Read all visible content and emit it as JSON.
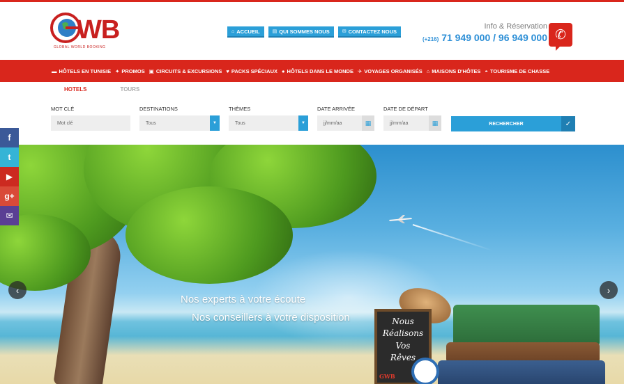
{
  "logo": {
    "text": "WB",
    "tagline": "GLOBAL WORLD BOOKING"
  },
  "topnav": [
    {
      "label": "ACCUEIL",
      "icon": "home-icon"
    },
    {
      "label": "QUI SOMMES NOUS",
      "icon": "file-icon"
    },
    {
      "label": "CONTACTEZ NOUS",
      "icon": "envelope-icon"
    }
  ],
  "contact": {
    "label": "Info & Réservation",
    "prefix": "(+216)",
    "numbers": "71 949 000 / 96 949 000"
  },
  "mainnav": [
    {
      "label": "HÔTELS EN TUNISIE",
      "icon": "bed-icon"
    },
    {
      "label": "PROMOS",
      "icon": "gift-icon"
    },
    {
      "label": "CIRCUITS & EXCURSIONS",
      "icon": "bus-icon"
    },
    {
      "label": "PACKS SPÉCIAUX",
      "icon": "heart-icon"
    },
    {
      "label": "HÔTELS DANS LE MONDE",
      "icon": "globe-icon"
    },
    {
      "label": "VOYAGES ORGANISÉS",
      "icon": "plane-icon"
    },
    {
      "label": "MAISONS D'HÔTES",
      "icon": "home-icon"
    },
    {
      "label": "TOURISME DE CHASSE",
      "icon": "hat-icon"
    }
  ],
  "tabs": {
    "hotels": "HOTELS",
    "tours": "TOURS"
  },
  "search": {
    "keyword_label": "MOT CLÉ",
    "keyword_placeholder": "Mot clé",
    "destinations_label": "DESTINATIONS",
    "destinations_value": "Tous",
    "themes_label": "THÈMES",
    "themes_value": "Tous",
    "arrival_label": "DATE ARRIVÉE",
    "arrival_placeholder": "jj/mm/aa",
    "departure_label": "DATE DE DÉPART",
    "departure_placeholder": "jj/mm/aa",
    "submit": "RECHERCHER"
  },
  "hero": {
    "line1": "Nos experts à votre écoute",
    "line2": "Nos conseillers à votre disposition",
    "board_lines": [
      "Nous",
      "Réalisons",
      "Vos",
      "Rêves"
    ],
    "board_logo": "GWB"
  },
  "social": [
    {
      "icon": "facebook-icon",
      "glyph": "f",
      "color": "#3b5998"
    },
    {
      "icon": "twitter-icon",
      "glyph": "t",
      "color": "#35b4d6"
    },
    {
      "icon": "youtube-icon",
      "glyph": "▶",
      "color": "#cc2a20"
    },
    {
      "icon": "googleplus-icon",
      "glyph": "g+",
      "color": "#d94a38"
    },
    {
      "icon": "email-icon",
      "glyph": "✉",
      "color": "#5a3f94"
    }
  ],
  "colors": {
    "brand_red": "#d9261c",
    "accent_blue": "#2b9fd8"
  }
}
